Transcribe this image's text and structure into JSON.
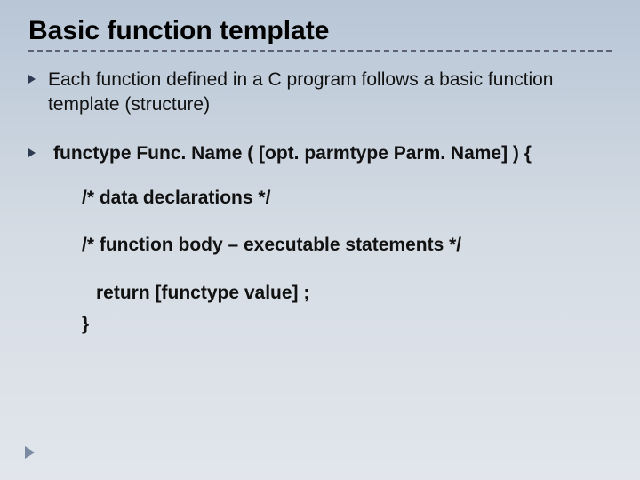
{
  "title": "Basic function template",
  "bullets": [
    "Each function defined in a C program follows a basic function template (structure)",
    "functype   Func. Name ( [opt. parmtype Parm. Name] ) {"
  ],
  "code": {
    "l1": "/* data declarations */",
    "l2": "/* function body – executable statements */",
    "ret": "return [functype value] ;",
    "close": "}"
  }
}
